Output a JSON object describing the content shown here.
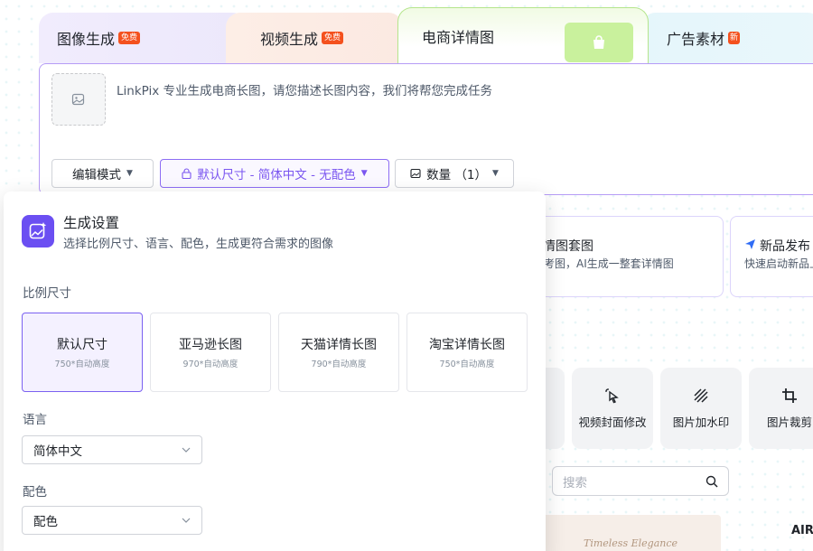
{
  "tabs": [
    {
      "label": "图像生成",
      "badge": "免费"
    },
    {
      "label": "视频生成",
      "badge": "免费"
    },
    {
      "label": "电商详情图",
      "badge": ""
    },
    {
      "label": "广告素材",
      "badge": "新"
    }
  ],
  "prompt": {
    "placeholder": "LinkPix 专业生成电商长图，请您描述长图内容，我们将帮您完成任务"
  },
  "toolbar": {
    "mode_label": "编辑模式",
    "size_label": "默认尺寸 - 简体中文 - 无配色",
    "count_label": "数量 （1）"
  },
  "cards": [
    {
      "title": "情图套图",
      "desc": "考图，AI生成一整套详情图"
    },
    {
      "title": "新品发布",
      "desc": "快速启动新品上"
    }
  ],
  "tools": [
    {
      "label": "视频封面修改"
    },
    {
      "label": "图片加水印"
    },
    {
      "label": "图片裁剪"
    }
  ],
  "search": {
    "placeholder": "搜索"
  },
  "thumbnail": {
    "caption": "Timeless Elegance"
  },
  "air_text": "AIR",
  "settings": {
    "title": "生成设置",
    "subtitle": "选择比例尺寸、语言、配色，生成更符合需求的图像",
    "ratio_label": "比例尺寸",
    "ratios": [
      {
        "name": "默认尺寸",
        "sub": "750*自动高度"
      },
      {
        "name": "亚马逊长图",
        "sub": "970*自动高度"
      },
      {
        "name": "天猫详情长图",
        "sub": "790*自动高度"
      },
      {
        "name": "淘宝详情长图",
        "sub": "750*自动高度"
      }
    ],
    "language_label": "语言",
    "language_value": "简体中文",
    "color_label": "配色",
    "color_value": "配色"
  },
  "colors": {
    "accent": "#6b4ff2",
    "badge": "#f4511e"
  }
}
